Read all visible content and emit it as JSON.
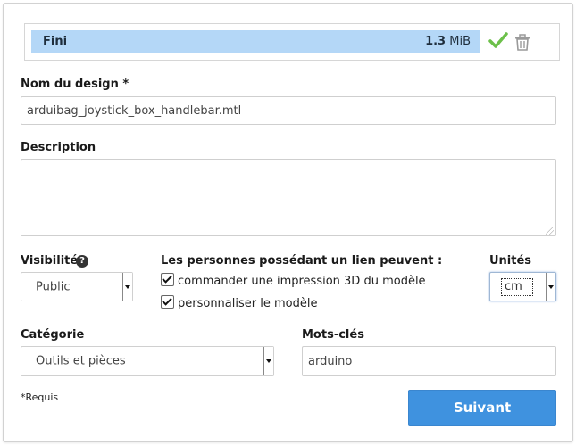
{
  "upload": {
    "status": "Fini",
    "size_value": "1.3",
    "size_unit": "MiB",
    "check_color": "#6cc04a",
    "icons": [
      "checkmark-icon",
      "trash-icon"
    ]
  },
  "design_name": {
    "label": "Nom du design *",
    "value": "arduibag_joystick_box_handlebar.mtl"
  },
  "description": {
    "label": "Description",
    "value": ""
  },
  "visibility": {
    "label": "Visibilité",
    "help_icon": "?",
    "selected": "Public"
  },
  "link_permissions": {
    "label": "Les personnes possédant un lien peuvent :",
    "options": [
      {
        "label": "commander une impression 3D du modèle",
        "checked": true
      },
      {
        "label": "personnaliser le modèle",
        "checked": true
      }
    ]
  },
  "units": {
    "label": "Unités",
    "selected": "cm"
  },
  "category": {
    "label": "Catégorie",
    "selected": "Outils et pièces"
  },
  "keywords": {
    "label": "Mots-clés",
    "value": "arduino"
  },
  "footer": {
    "required_note": "*Requis",
    "next_button": "Suivant",
    "button_color": "#3f92df"
  }
}
